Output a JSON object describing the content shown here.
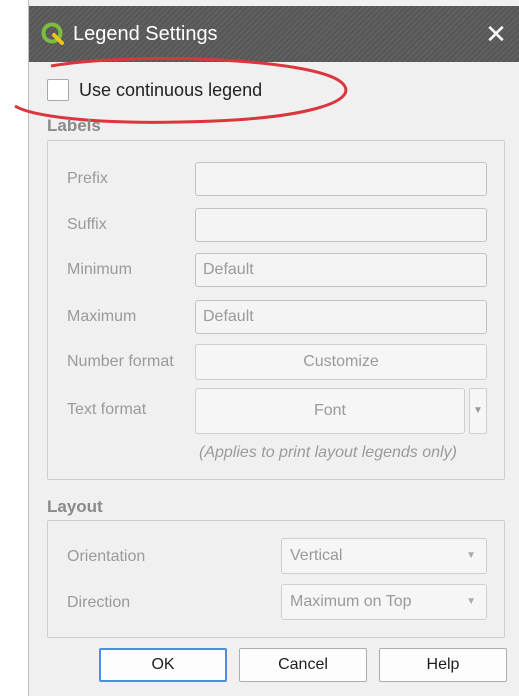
{
  "dialog": {
    "title": "Legend Settings",
    "close_glyph": "✕",
    "logo_icon": "qgis-logo-icon"
  },
  "continuous": {
    "label": "Use continuous legend",
    "checked": false,
    "annotation_color": "#d9363e"
  },
  "labels_section": {
    "title": "Labels",
    "prefix_label": "Prefix",
    "prefix_value": "",
    "suffix_label": "Suffix",
    "suffix_value": "",
    "minimum_label": "Minimum",
    "minimum_value": "Default",
    "maximum_label": "Maximum",
    "maximum_value": "Default",
    "number_format_label": "Number format",
    "number_format_button": "Customize",
    "text_format_label": "Text format",
    "text_format_button": "Font",
    "note": "(Applies to print layout legends only)"
  },
  "layout_section": {
    "title": "Layout",
    "orientation_label": "Orientation",
    "orientation_value": "Vertical",
    "direction_label": "Direction",
    "direction_value": "Maximum on Top"
  },
  "buttons": {
    "ok": "OK",
    "cancel": "Cancel",
    "help": "Help"
  },
  "colors": {
    "titlebar": "#5a5a5a",
    "accent": "#4a8ee2",
    "logo_green": "#7cbd3b"
  }
}
